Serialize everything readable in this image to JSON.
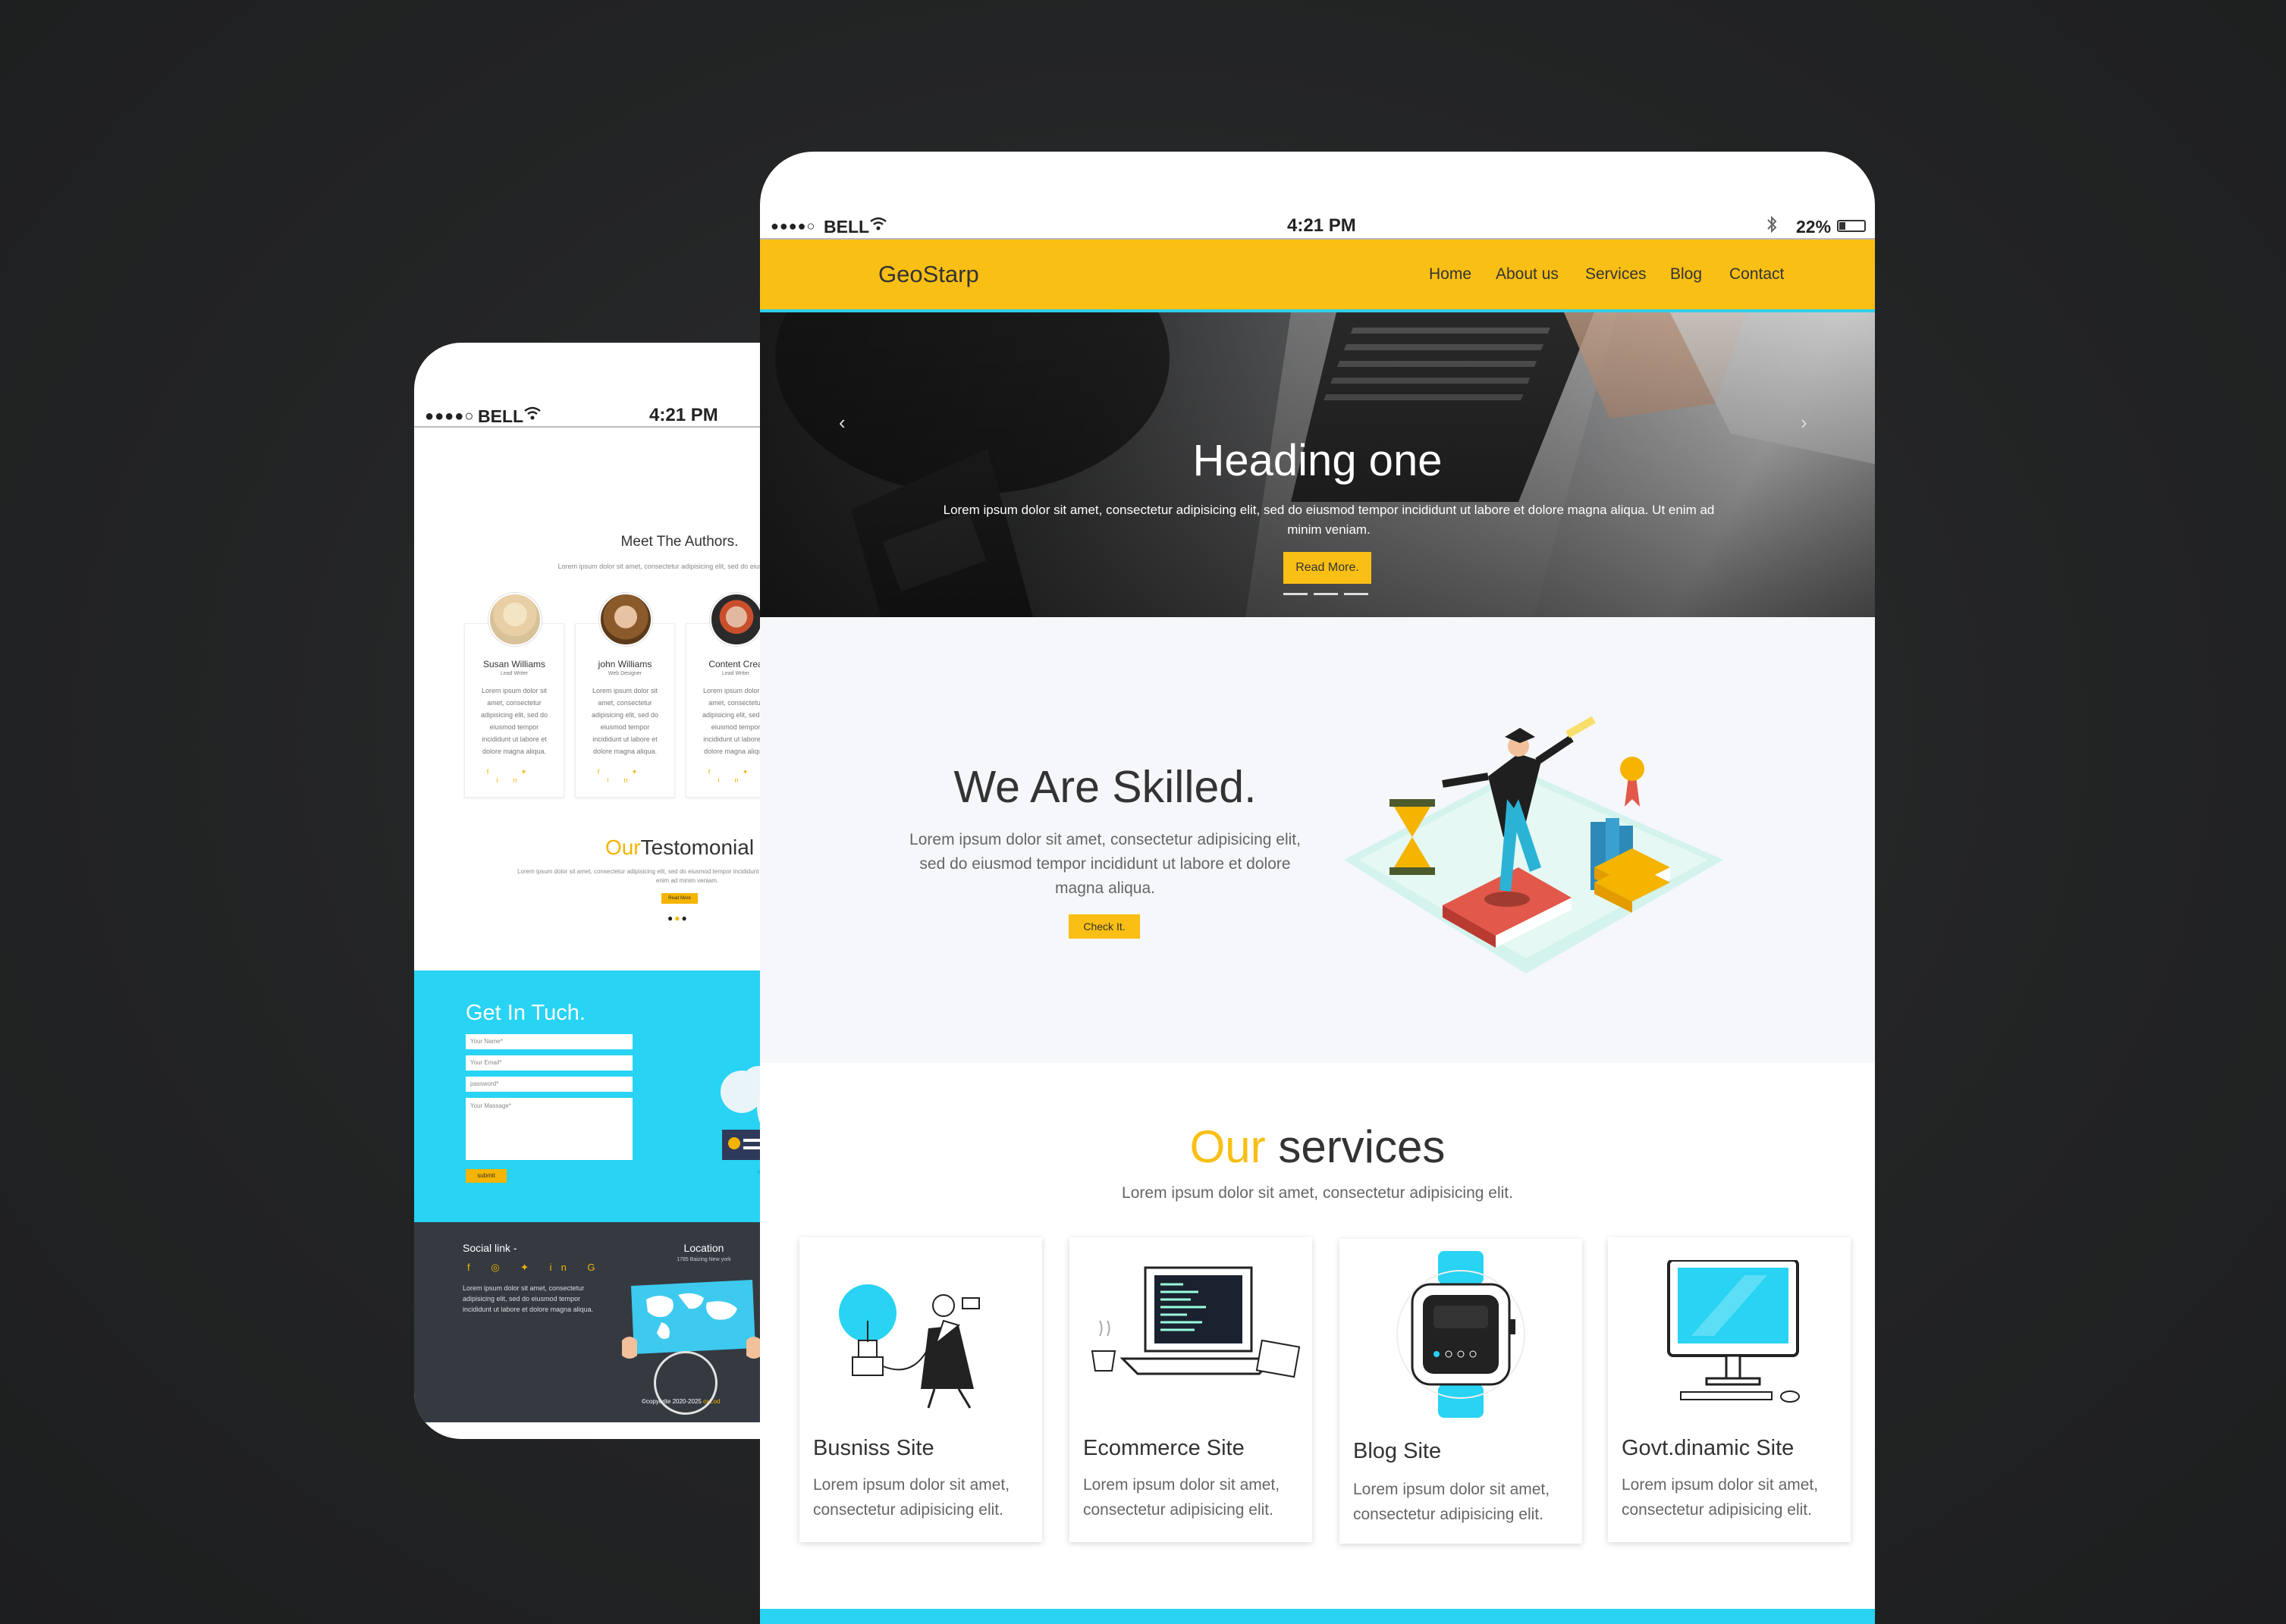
{
  "phone": {
    "status": {
      "signal": "●●●●○",
      "carrier": "BELL",
      "time": "4:21 PM"
    },
    "authors": {
      "title": "Meet The Authors.",
      "subtitle": "Lorem ipsum dolor sit amet, consectetur adipisicing elit, sed do eiusmod tempor incidi",
      "cards": [
        {
          "name": "Susan Williams",
          "role": "Lead Writer",
          "text": "Lorem ipsum dolor sit amet, consectetur adipisicing elit, sed do eiusmod tempor incididunt ut labore et dolore magna aliqua.",
          "social": "f  ✦  in"
        },
        {
          "name": "john Williams",
          "role": "Web Designer",
          "text": "Lorem ipsum dolor sit amet, consectetur adipisicing elit, sed do eiusmod tempor incididunt ut labore et dolore magna aliqua.",
          "social": "f  ✦  in"
        },
        {
          "name": "Content Crea",
          "role": "Lead Writer",
          "text": "Lorem ipsum dolor sit amet, consectetur adipisicing elit, sed do eiusmod tempor incididunt ut labore et dolore magna aliqua.",
          "social": "f  ✦  in"
        }
      ]
    },
    "testimonial": {
      "title_accent": "Our",
      "title_rest": "Testomonial",
      "text": "Lorem ipsum dolor sit amet, consectetur adipisicing elit, sed do eiusmod tempor incididunt ut labore et dolore magna aliqua. Ut enim ad minim veniam.",
      "button": "Read More"
    },
    "contact": {
      "title": "Get In Tuch.",
      "fields": [
        {
          "placeholder": "Your Name*"
        },
        {
          "placeholder": "Your Email*"
        },
        {
          "placeholder": "password*"
        },
        {
          "placeholder": "Your Massage*"
        }
      ],
      "submit": "submit"
    },
    "footer": {
      "social_title": "Social link -",
      "social_icons": "f ◎ ✦ in G",
      "social_text": "Lorem ipsum dolor sit amet, consectetur adipisicing elit, sed do eiusmod tempor incididunt ut labore et dolore magna aliqua.",
      "location_title": "Location",
      "location_sub": "1785 Baizing New york",
      "copyright_prefix": "©copyerite 2020-2025",
      "copyright_brand": "oxZod"
    }
  },
  "tablet": {
    "status": {
      "signal": "●●●●○",
      "carrier": "BELL",
      "time": "4:21 PM",
      "battery": "22%"
    },
    "nav": {
      "brand": "GeoStarp",
      "links": [
        "Home",
        "About us",
        "Services",
        "Blog",
        "Contact"
      ]
    },
    "hero": {
      "heading": "Heading one",
      "text": "Lorem ipsum dolor sit amet, consectetur adipisicing elit, sed do eiusmod tempor incididunt ut labore et dolore magna aliqua. Ut enim ad minim veniam.",
      "button": "Read More."
    },
    "skilled": {
      "heading": "We Are Skilled.",
      "text": "Lorem ipsum dolor sit amet, consectetur adipisicing elit, sed do eiusmod tempor incididunt ut labore et dolore magna aliqua.",
      "button": "Check It."
    },
    "services": {
      "title_accent": "Our",
      "title_rest": " services",
      "subtitle": "Lorem ipsum dolor sit amet, consectetur adipisicing elit.",
      "cards": [
        {
          "title": "Busniss Site",
          "text": "Lorem ipsum dolor sit amet, consectetur adipisicing elit."
        },
        {
          "title": "Ecommerce Site",
          "text": "Lorem ipsum dolor sit amet, consectetur adipisicing elit."
        },
        {
          "title": "Blog Site",
          "text": "Lorem ipsum dolor sit amet, consectetur adipisicing elit."
        },
        {
          "title": "Govt.dinamic Site",
          "text": "Lorem ipsum dolor sit amet, consectetur adipisicing elit."
        }
      ]
    }
  },
  "colors": {
    "yellow": "#f9bf14",
    "cyan": "#28d3f3",
    "dark": "#343a40",
    "background": "#232425"
  }
}
